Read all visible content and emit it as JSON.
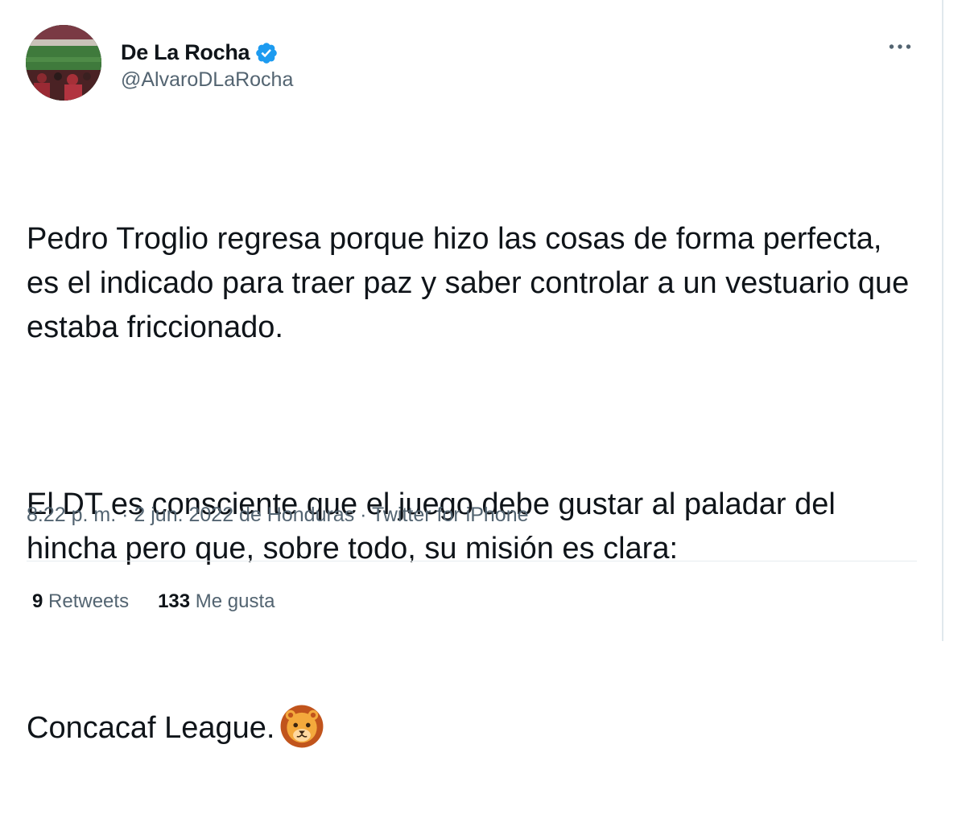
{
  "author": {
    "display_name": "De La Rocha",
    "handle": "@AlvaroDLaRocha",
    "verified_badge_icon": "verified-badge-icon",
    "avatar_icon": "stadium-photo-avatar"
  },
  "menu_icon": "more-options-icon",
  "tweet": {
    "paragraphs": [
      "Pedro Troglio regresa porque hizo las cosas de forma perfecta, es el indicado para traer paz y saber controlar a un vestuario que estaba friccionado.",
      "El DT es consciente que el juego debe gustar al paladar del hincha pero que, sobre todo, su misión es clara:",
      "Concacaf League."
    ],
    "emoji_icon": "lion-face-emoji"
  },
  "meta": {
    "time": "8:22 p. m.",
    "separator": " · ",
    "date": "2 jun. 2022",
    "location": " de Honduras",
    "separator2": " · ",
    "source": "Twitter for iPhone"
  },
  "stats": {
    "retweets_count": "9",
    "retweets_label": "Retweets",
    "likes_count": "133",
    "likes_label": "Me gusta"
  },
  "colors": {
    "text": "#0f1419",
    "secondary": "#536471",
    "verified": "#1d9bf0",
    "divider": "#e6ecf0"
  }
}
